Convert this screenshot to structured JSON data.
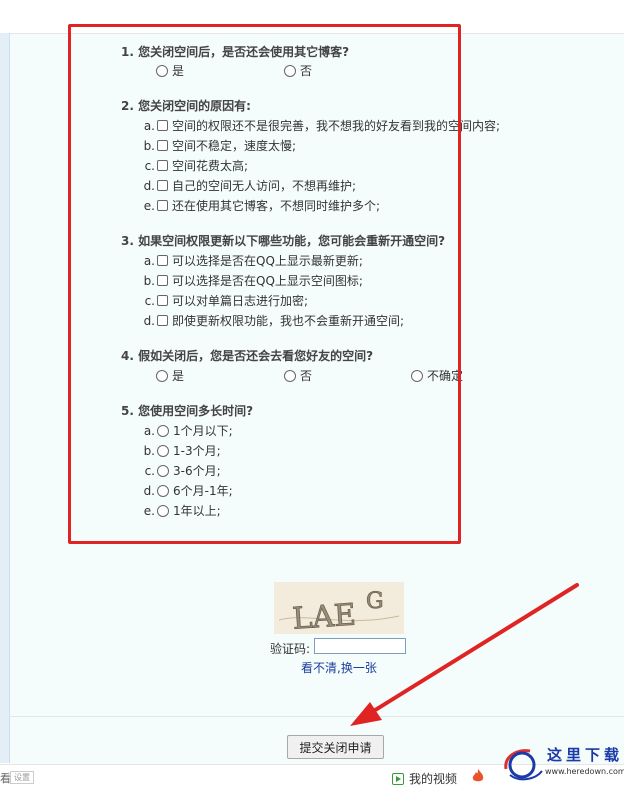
{
  "questions": [
    {
      "title": "1. 您关闭空间后，是否还会使用其它博客?",
      "options": [
        "是",
        "否"
      ]
    },
    {
      "title": "2. 您关闭空间的原因有:",
      "options": [
        {
          "letter": "a.",
          "text": "空间的权限还不是很完善，我不想我的好友看到我的空间内容;"
        },
        {
          "letter": "b.",
          "text": "空间不稳定，速度太慢;"
        },
        {
          "letter": "c.",
          "text": "空间花费太高;"
        },
        {
          "letter": "d.",
          "text": "自己的空间无人访问，不想再维护;"
        },
        {
          "letter": "e.",
          "text": "还在使用其它博客，不想同时维护多个;"
        }
      ]
    },
    {
      "title": "3. 如果空间权限更新以下哪些功能，您可能会重新开通空间?",
      "options": [
        {
          "letter": "a.",
          "text": "可以选择是否在QQ上显示最新更新;"
        },
        {
          "letter": "b.",
          "text": "可以选择是否在QQ上显示空间图标;"
        },
        {
          "letter": "c.",
          "text": "可以对单篇日志进行加密;"
        },
        {
          "letter": "d.",
          "text": "即使更新权限功能，我也不会重新开通空间;"
        }
      ]
    },
    {
      "title": "4. 假如关闭后，您是否还会去看您好友的空间?",
      "options": [
        "是",
        "否",
        "不确定"
      ]
    },
    {
      "title": "5. 您使用空间多长时间?",
      "options": [
        {
          "letter": "a.",
          "text": "1个月以下;"
        },
        {
          "letter": "b.",
          "text": "1-3个月;"
        },
        {
          "letter": "c.",
          "text": "3-6个月;"
        },
        {
          "letter": "d.",
          "text": "6个月-1年;"
        },
        {
          "letter": "e.",
          "text": "1年以上;"
        }
      ]
    }
  ],
  "captcha": {
    "image_text": "LAEG",
    "label": "验证码:",
    "input_value": "",
    "refresh_link": "看不清,换一张"
  },
  "submit_label": "提交关闭申请",
  "bottom_bar": {
    "left_text": "看",
    "left_box": "设置",
    "video_label": "我的视频"
  },
  "watermark": {
    "title": "这里下载",
    "url": "www.heredown.com"
  },
  "colors": {
    "highlight_box": "#e02424",
    "arrow": "#e02424",
    "link": "#1a3d9c",
    "content_bg": "#f5fcfc"
  }
}
